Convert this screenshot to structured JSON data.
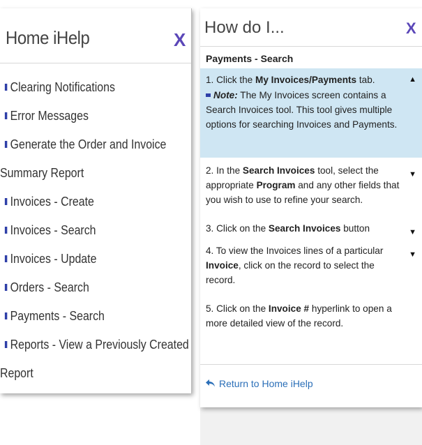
{
  "left": {
    "title": "Home iHelp",
    "close": "X",
    "items": [
      {
        "label": "Clearing Notifications"
      },
      {
        "label": "Error Messages"
      },
      {
        "label": "Generate the Order and Invoice",
        "label2": "Summary Report"
      },
      {
        "label": "Invoices - Create"
      },
      {
        "label": "Invoices - Search"
      },
      {
        "label": "Invoices - Update"
      },
      {
        "label": "Orders - Search"
      },
      {
        "label": "Payments - Search"
      },
      {
        "label": "Reports - View a Previously Created",
        "label2": "Report"
      }
    ]
  },
  "right": {
    "title": "How do I...",
    "close": "X",
    "section": "Payments - Search",
    "steps": [
      {
        "pre": "1. Click the ",
        "bold": "My Invoices/Payments",
        "post": " tab.",
        "arrow": "▲"
      },
      {
        "note_label": "Note:",
        "note_text": " The My Invoices screen contains a Search Invoices tool. This tool gives multiple options for searching Invoices and Payments."
      },
      {
        "pre": "2. In the ",
        "bold": "Search Invoices",
        "mid": " tool, select the appropriate ",
        "bold2": "Program",
        "post": " and any other fields that you wish to use to refine your search.",
        "arrow": "▼"
      },
      {
        "pre": "3. Click on the ",
        "bold": "Search Invoices",
        "post": " button",
        "arrow": "▼"
      },
      {
        "pre": "4. To view the Invoices lines of a particular ",
        "bold": "Invoice",
        "post": ", click on the record to select the record.",
        "arrow": "▼"
      },
      {
        "pre": "5. Click on the ",
        "bold": "Invoice #",
        "post": " hyperlink to open a more detailed view of the record."
      }
    ],
    "return_label": "Return to Home iHelp",
    "return_icon": "reply-arrow-icon"
  },
  "colors": {
    "accent": "#5b47b8",
    "bullet": "#2e3fa8",
    "active_bg": "#cfe6f3",
    "link": "#2b6fb8"
  }
}
